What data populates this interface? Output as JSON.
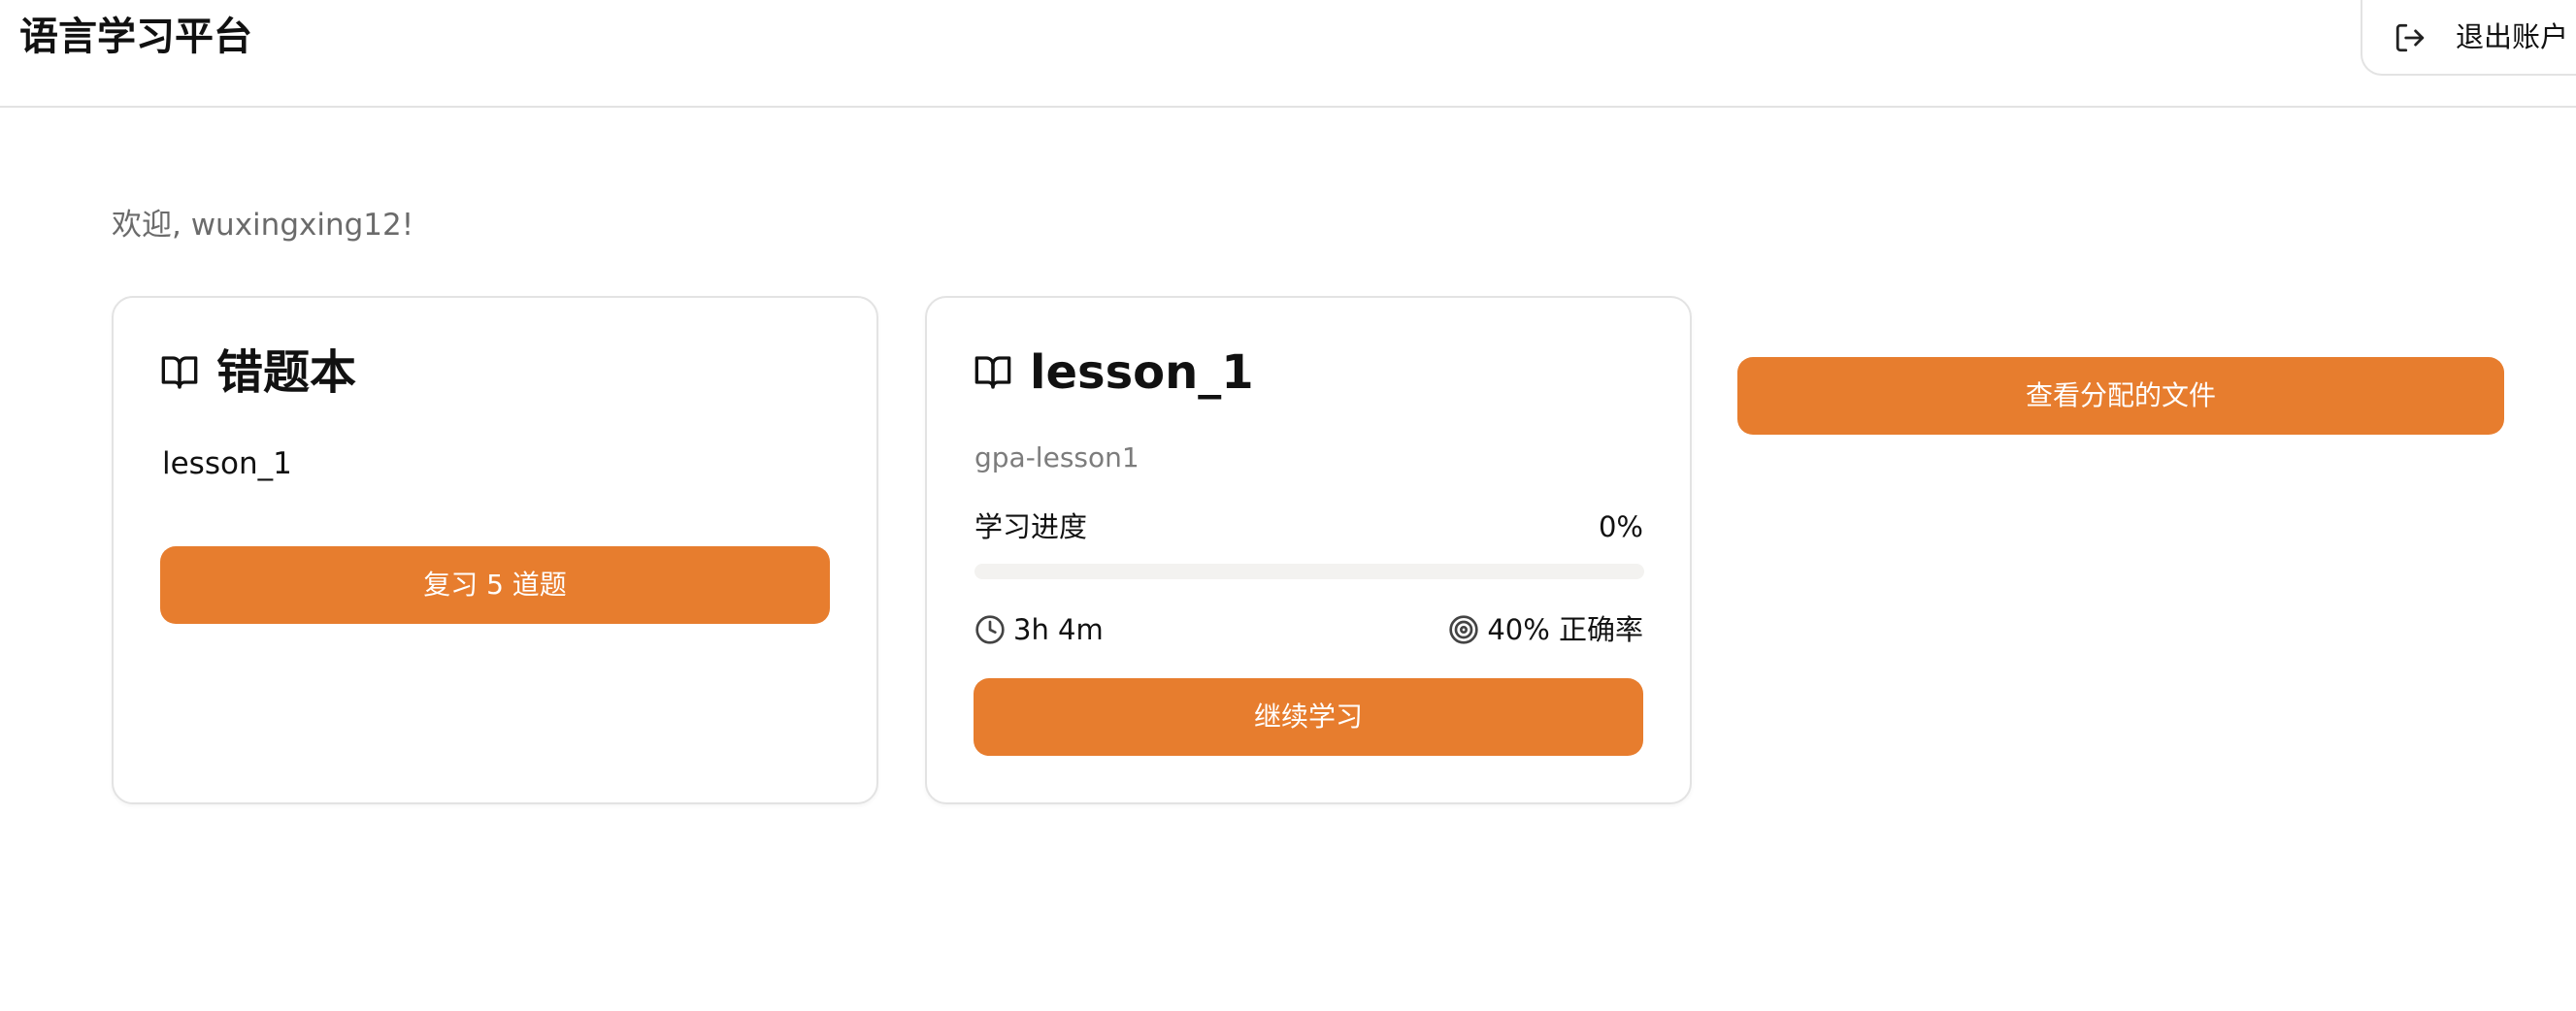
{
  "header": {
    "app_title": "语言学习平台",
    "logout_label": "退出账户"
  },
  "main": {
    "welcome": "欢迎, wuxingxing12!",
    "notebook_card": {
      "title": "错题本",
      "item": "lesson_1",
      "review_button_label": "复习 5 道题"
    },
    "lesson_card": {
      "title": "lesson_1",
      "subtitle": "gpa-lesson1",
      "progress_label": "学习进度",
      "progress_value": "0%",
      "progress_fraction": 0,
      "time_spent": "3h 4m",
      "accuracy": "40% 正确率",
      "continue_button_label": "继续学习"
    },
    "files_button_label": "查看分配的文件"
  },
  "colors": {
    "accent": "#e77d2e",
    "border": "#e3e3e3",
    "muted_text": "#6b6b6b",
    "progress_track": "#f3f2f0"
  },
  "icons": {
    "logout": "logout-icon",
    "book": "book-open-icon",
    "clock": "clock-icon",
    "target": "target-icon"
  }
}
